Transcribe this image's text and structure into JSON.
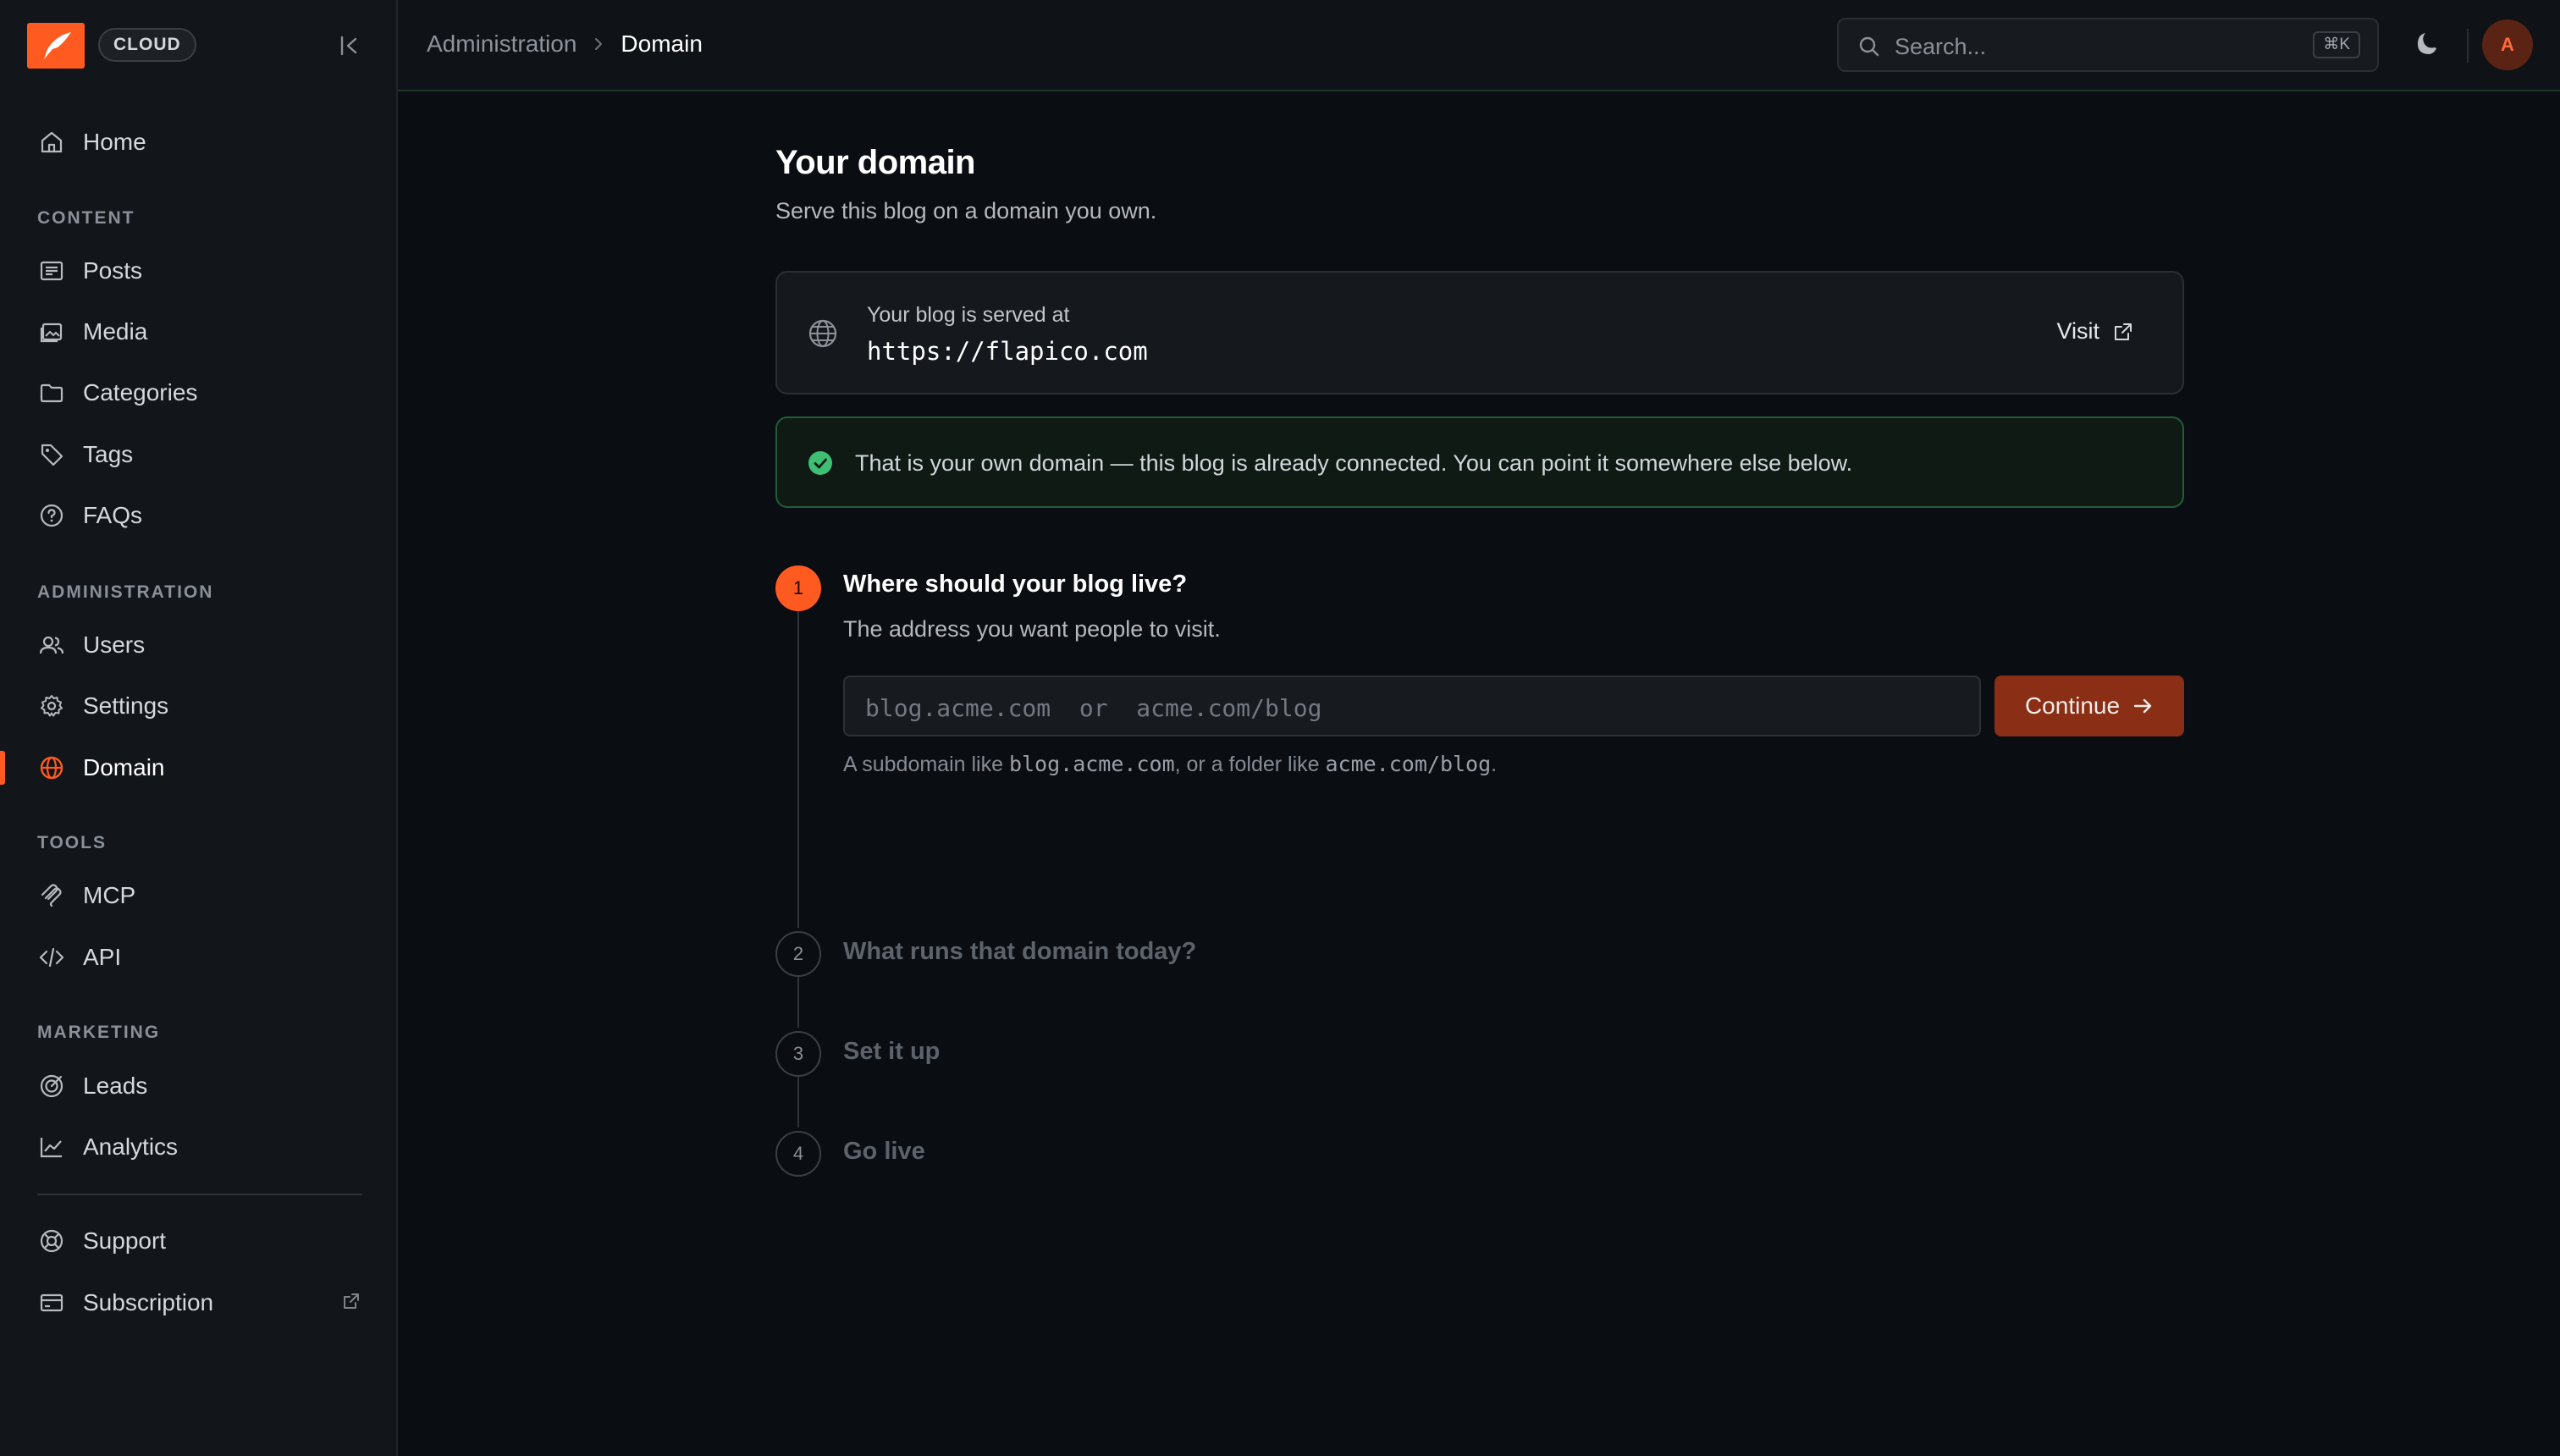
{
  "brand": {
    "badge": "CLOUD",
    "accent": "#ff5a1f"
  },
  "sidebar": {
    "home": "Home",
    "sections": {
      "content": "CONTENT",
      "administration": "ADMINISTRATION",
      "tools": "TOOLS",
      "marketing": "MARKETING"
    },
    "content": {
      "posts": "Posts",
      "media": "Media",
      "categories": "Categories",
      "tags": "Tags",
      "faqs": "FAQs"
    },
    "administration": {
      "users": "Users",
      "settings": "Settings",
      "domain": "Domain"
    },
    "tools": {
      "mcp": "MCP",
      "api": "API"
    },
    "marketing": {
      "leads": "Leads",
      "analytics": "Analytics"
    },
    "footer": {
      "support": "Support",
      "subscription": "Subscription"
    },
    "active_item": "Domain"
  },
  "header": {
    "breadcrumb": {
      "parent": "Administration",
      "current": "Domain"
    },
    "search": {
      "placeholder": "Search...",
      "shortcut": "⌘K"
    },
    "avatar_initial": "A"
  },
  "main": {
    "title": "Your domain",
    "subtitle": "Serve this blog on a domain you own.",
    "served": {
      "label": "Your blog is served at",
      "url": "https://flapico.com",
      "visit": "Visit"
    },
    "notice": "That is your own domain — this blog is already connected. You can point it somewhere else below.",
    "steps": [
      {
        "number": "1",
        "title": "Where should your blog live?",
        "description": "The address you want people to visit."
      },
      {
        "number": "2",
        "title": "What runs that domain today?"
      },
      {
        "number": "3",
        "title": "Set it up"
      },
      {
        "number": "4",
        "title": "Go live"
      }
    ],
    "domain_input": {
      "placeholder": "blog.acme.com  or  acme.com/blog"
    },
    "continue": "Continue",
    "hint": {
      "pre": "A subdomain like ",
      "code1": "blog.acme.com",
      "mid": ", or a folder like ",
      "code2": "acme.com/blog",
      "post": "."
    }
  }
}
